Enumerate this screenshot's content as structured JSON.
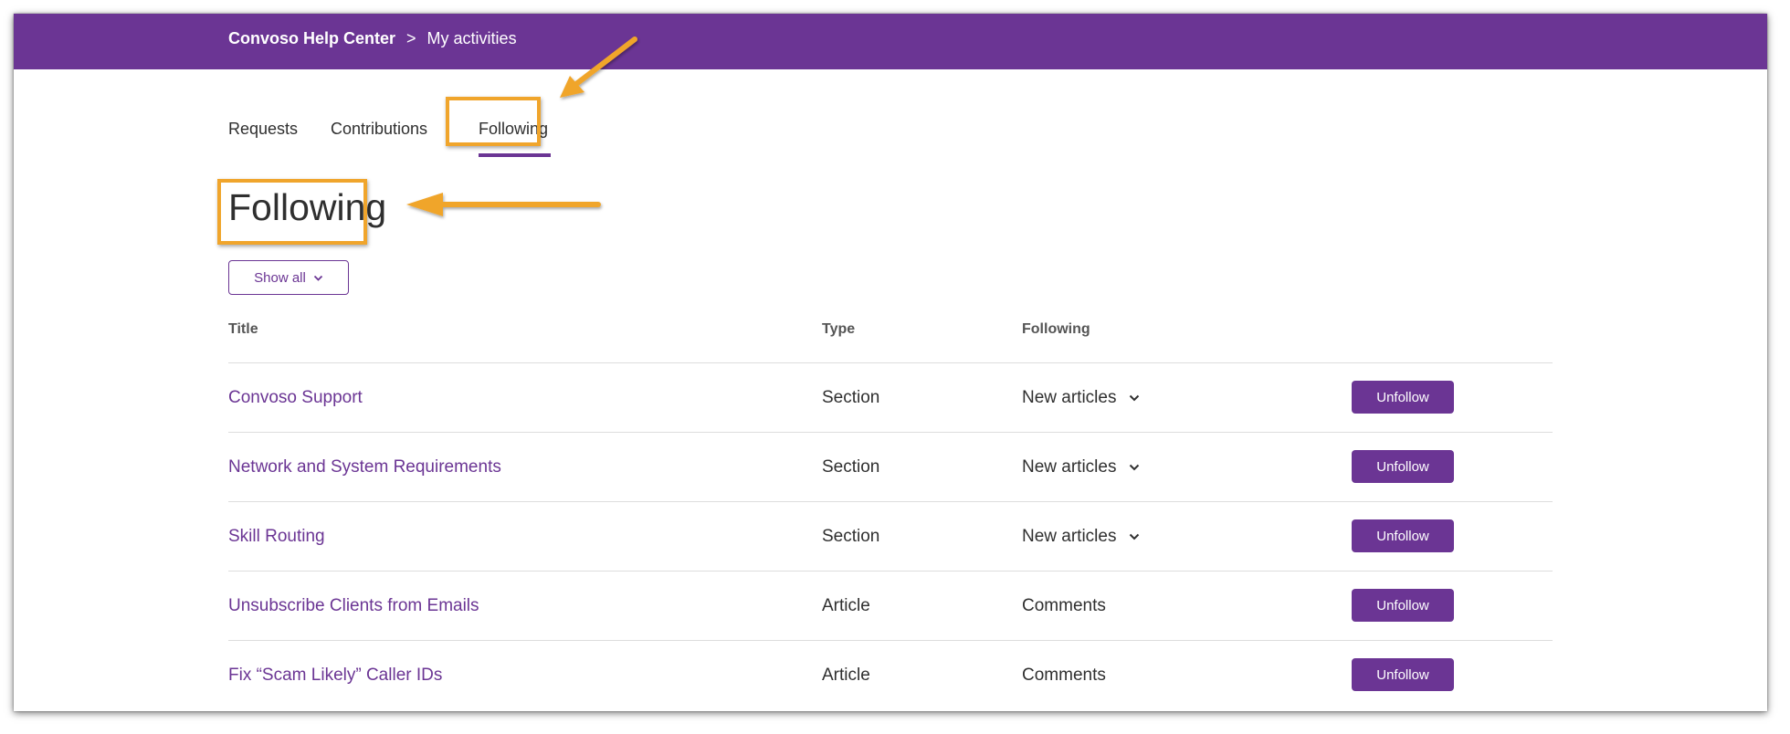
{
  "header": {
    "home_label": "Convoso Help Center",
    "separator": ">",
    "current_label": "My activities"
  },
  "tabs": [
    {
      "label": "Requests",
      "active": false
    },
    {
      "label": "Contributions",
      "active": false
    },
    {
      "label": "Following",
      "active": true
    }
  ],
  "page_title": "Following",
  "filter": {
    "label": "Show all",
    "icon": "chevron-down-icon"
  },
  "table": {
    "columns": [
      "Title",
      "Type",
      "Following"
    ],
    "rows": [
      {
        "title": "Convoso Support",
        "type": "Section",
        "following": "New articles",
        "has_dropdown": true,
        "action": "Unfollow"
      },
      {
        "title": "Network and System Requirements",
        "type": "Section",
        "following": "New articles",
        "has_dropdown": true,
        "action": "Unfollow"
      },
      {
        "title": "Skill Routing",
        "type": "Section",
        "following": "New articles",
        "has_dropdown": true,
        "action": "Unfollow"
      },
      {
        "title": "Unsubscribe Clients from Emails",
        "type": "Article",
        "following": "Comments",
        "has_dropdown": false,
        "action": "Unfollow"
      },
      {
        "title": "Fix “Scam Likely” Caller IDs",
        "type": "Article",
        "following": "Comments",
        "has_dropdown": false,
        "action": "Unfollow"
      }
    ]
  },
  "colors": {
    "brand": "#6b3594",
    "annotation": "#f0a52c",
    "text": "#2f2f2f",
    "header_text": "#ffffff"
  }
}
